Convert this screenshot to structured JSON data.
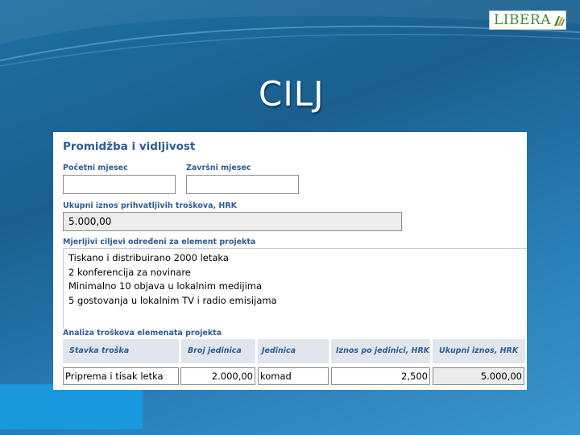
{
  "brand": {
    "logo_text": "LIBERA",
    "logo_color": "#3e8a3b"
  },
  "slide": {
    "title": "CILJ"
  },
  "form": {
    "section_title": "Promidžba i vidljivost",
    "start_month": {
      "label": "Početni mjesec",
      "value": ""
    },
    "end_month": {
      "label": "Završni mjesec",
      "value": ""
    },
    "total_cost": {
      "label": "Ukupni iznos prihvatljivih troškova, HRK",
      "value": "5.000,00"
    },
    "goals": {
      "label": "Mjerljivi ciljevi određeni za element projekta",
      "lines": [
        "Tiskano i distribuirano 2000 letaka",
        "2 konferencija za novinare",
        "Minimalno 10 objava u lokalnim medijima",
        "5 gostovanja u lokalnim TV i radio emisijama"
      ]
    },
    "cost_analysis": {
      "label": "Analiza troškova elemenata projekta",
      "columns": [
        "Stavka troška",
        "Broj jedinica",
        "Jedinica",
        "Iznos po jedinici, HRK",
        "Ukupni iznos, HRK"
      ],
      "rows": [
        [
          "Priprema i tisak letka",
          "2.000,00",
          "komad",
          "2,500",
          "5.000,00"
        ]
      ]
    }
  }
}
